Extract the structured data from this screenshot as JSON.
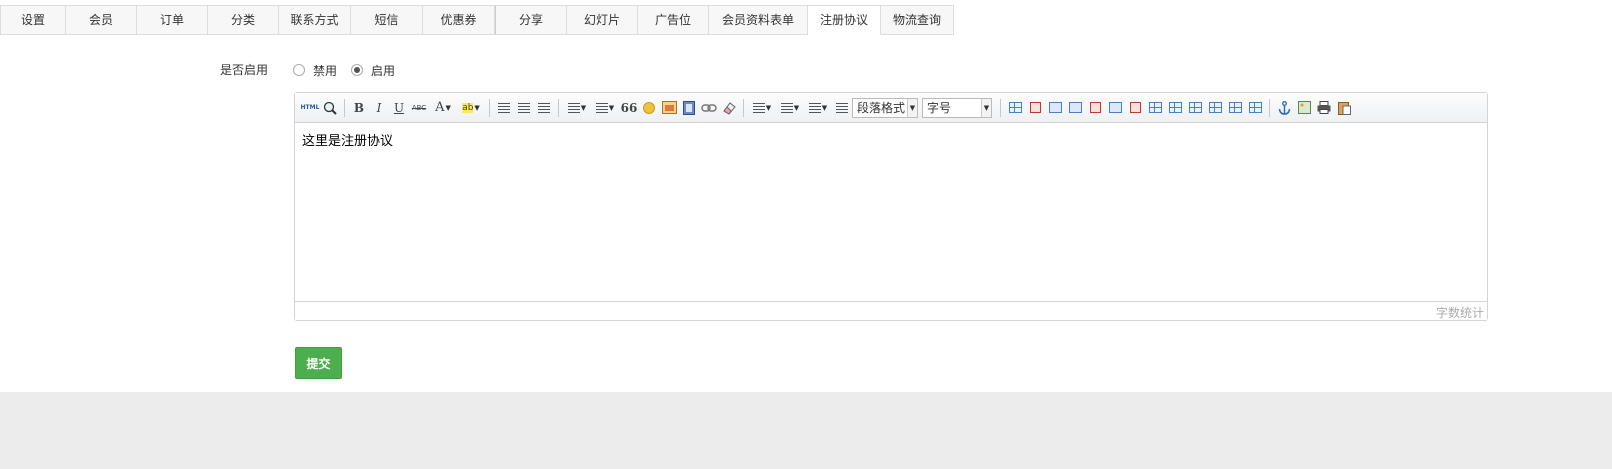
{
  "tabs": [
    {
      "label": "设置"
    },
    {
      "label": "会员"
    },
    {
      "label": "订单"
    },
    {
      "label": "分类"
    },
    {
      "label": "联系方式"
    },
    {
      "label": "短信"
    },
    {
      "label": "优惠券"
    },
    {
      "label": "分享"
    },
    {
      "label": "幻灯片"
    },
    {
      "label": "广告位"
    },
    {
      "label": "会员资料表单"
    },
    {
      "label": "注册协议",
      "active": true
    },
    {
      "label": "物流查询"
    }
  ],
  "form": {
    "enable_label": "是否启用",
    "radio_disabled": "禁用",
    "radio_enabled": "启用",
    "selected": "启用"
  },
  "editor": {
    "toolbar": {
      "html_label": "HTML",
      "bold": "B",
      "italic": "I",
      "underline": "U",
      "strike": "ABC",
      "fontcolor": "A",
      "backcolor": "ab",
      "quote": "66",
      "paragraph_select": "段落格式",
      "fontsize_select": "字号"
    },
    "content": "这里是注册协议",
    "wordcount_label": "字数统计"
  },
  "submit_label": "提交",
  "colors": {
    "submit_bg": "#4cae4c",
    "page_bg": "#ececec",
    "active_tab_bg": "#ffffff"
  }
}
